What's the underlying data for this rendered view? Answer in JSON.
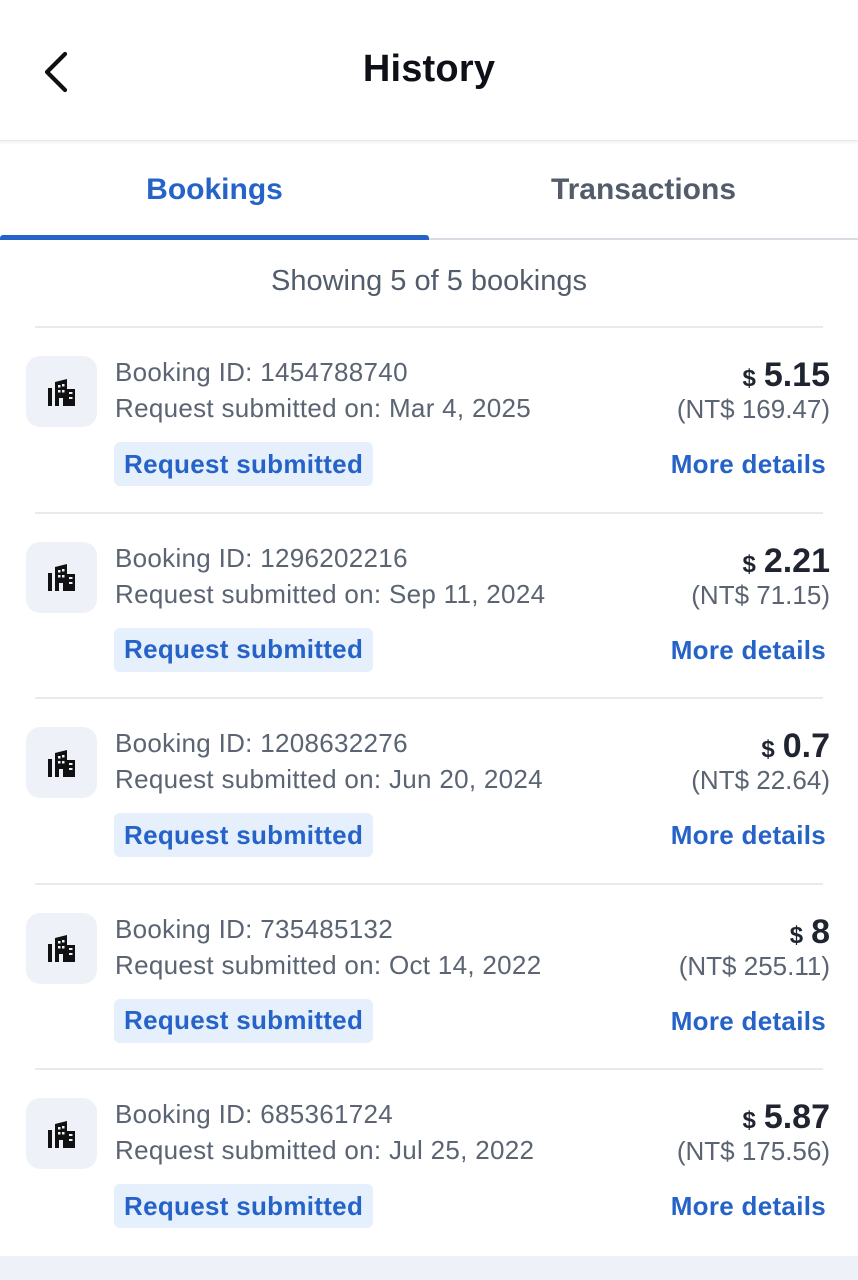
{
  "header": {
    "title": "History",
    "back_icon": "chevron-left-icon"
  },
  "tabs": [
    {
      "label": "Bookings",
      "active": true
    },
    {
      "label": "Transactions",
      "active": false
    }
  ],
  "summary": "Showing 5 of 5 bookings",
  "colors": {
    "accent": "#2563c9",
    "badge_bg": "#e6effc",
    "icon_bg": "#eef1f7"
  },
  "bookings": [
    {
      "icon": "hotel-icon",
      "id_text": "Booking ID: 1454788740",
      "submitted_text": "Request submitted on: Mar 4, 2025",
      "status": "Request submitted",
      "currency": "$",
      "amount": "5.15",
      "local_amount": "(NT$ 169.47)",
      "link": "More details"
    },
    {
      "icon": "hotel-icon",
      "id_text": "Booking ID: 1296202216",
      "submitted_text": "Request submitted on: Sep 11, 2024",
      "status": "Request submitted",
      "currency": "$",
      "amount": "2.21",
      "local_amount": "(NT$ 71.15)",
      "link": "More details"
    },
    {
      "icon": "hotel-icon",
      "id_text": "Booking ID: 1208632276",
      "submitted_text": "Request submitted on: Jun 20, 2024",
      "status": "Request submitted",
      "currency": "$",
      "amount": "0.7",
      "local_amount": "(NT$ 22.64)",
      "link": "More details"
    },
    {
      "icon": "hotel-icon",
      "id_text": "Booking ID: 735485132",
      "submitted_text": "Request submitted on: Oct 14, 2022",
      "status": "Request submitted",
      "currency": "$",
      "amount": "8",
      "local_amount": "(NT$ 255.11)",
      "link": "More details"
    },
    {
      "icon": "hotel-icon",
      "id_text": "Booking ID: 685361724",
      "submitted_text": "Request submitted on: Jul 25, 2022",
      "status": "Request submitted",
      "currency": "$",
      "amount": "5.87",
      "local_amount": "(NT$ 175.56)",
      "link": "More details"
    }
  ]
}
